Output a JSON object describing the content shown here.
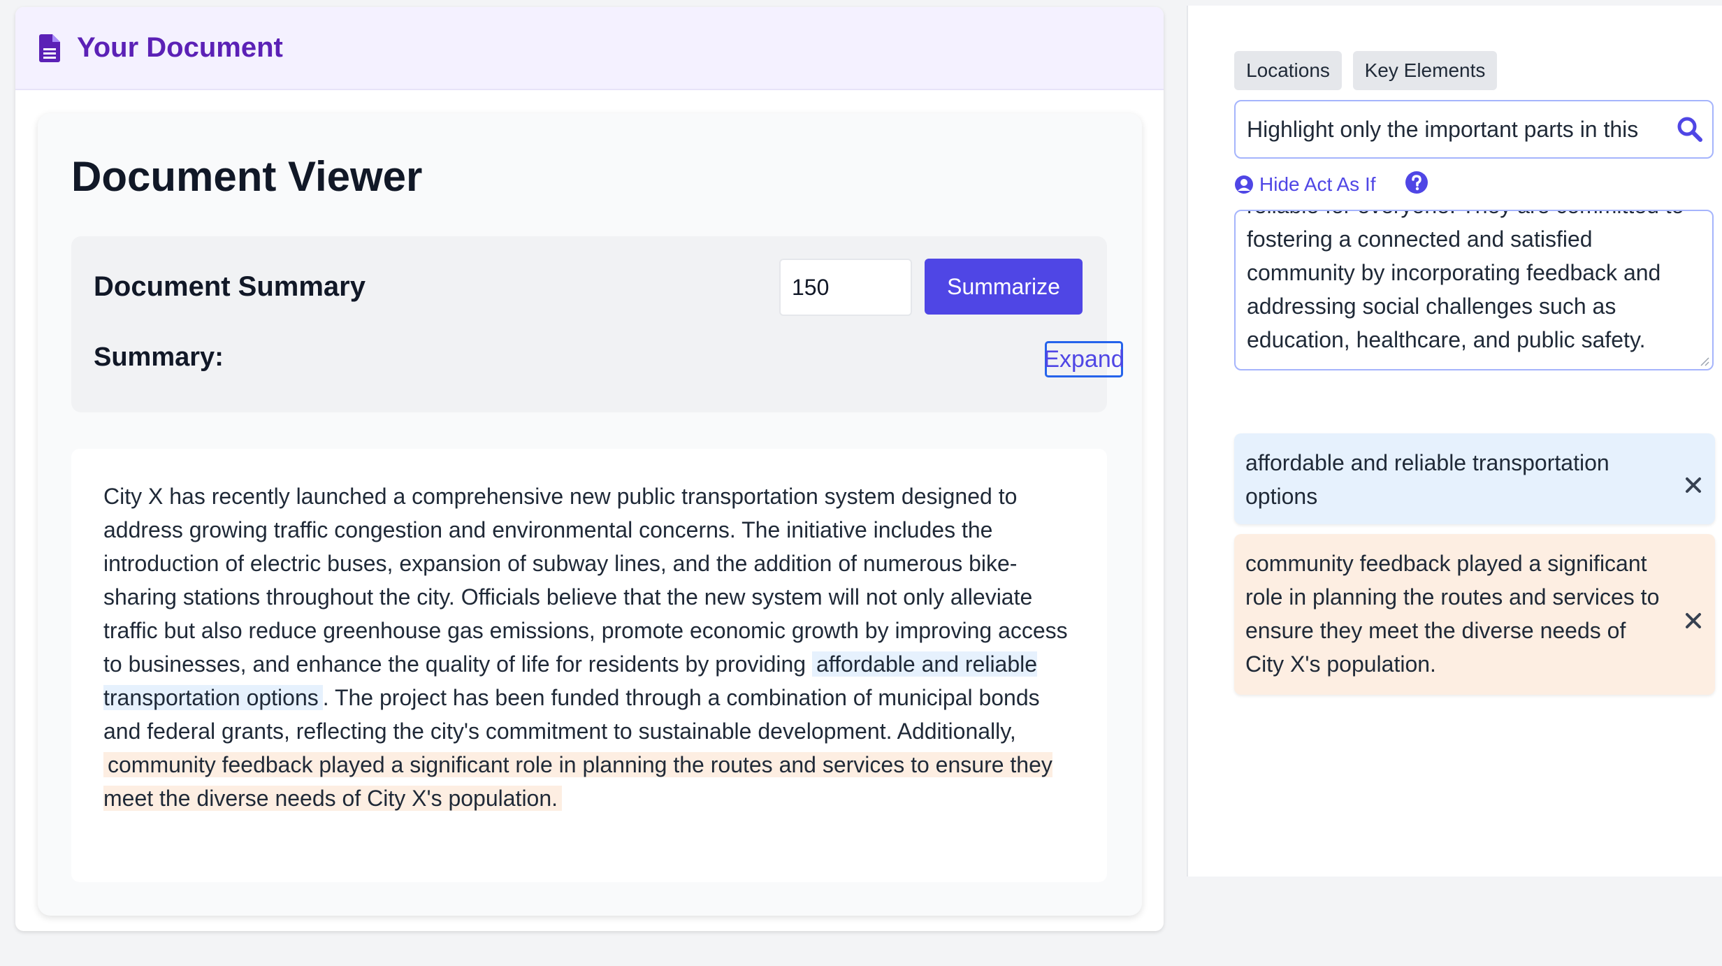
{
  "header": {
    "title": "Your Document",
    "icon": "document-icon"
  },
  "viewer": {
    "title": "Document Viewer",
    "summary": {
      "heading": "Document Summary",
      "length_value": "150",
      "summarize_label": "Summarize",
      "label": "Summary:",
      "expand_label": "Expand"
    },
    "body": {
      "p1": "City X has recently launched a comprehensive new public transportation system designed to address growing traffic congestion and environmental concerns. The initiative includes the introduction of electric buses, expansion of subway lines, and the addition of numerous bike-sharing stations throughout the city. Officials believe that the new system will not only alleviate traffic but also reduce greenhouse gas emissions, promote economic growth by improving access to businesses, and enhance the quality of life for residents by providing",
      "h1": "affordable and reliable transportation options",
      "p2": ". The project has been funded through a combination of municipal bonds and federal grants, reflecting the city's commitment to sustainable development. Additionally,",
      "h2": "community feedback played a significant role in planning the routes and services to ensure they meet the diverse needs of City X's population."
    }
  },
  "sidebar": {
    "tabs": [
      {
        "label": "Locations"
      },
      {
        "label": "Key Elements"
      }
    ],
    "search": {
      "value": "Highlight only the important parts in this",
      "icon": "search-icon"
    },
    "act_as_if": {
      "label": "Hide Act As If",
      "icon": "user-circle-icon",
      "help_icon": "question-circle-icon"
    },
    "act_text": "reliable for everyone. They are committed to fostering a connected and satisfied community by incorporating feedback and addressing social challenges such as education, healthcare, and public safety.",
    "highlights": [
      {
        "text": "affordable and reliable transportation options",
        "color": "#e6f1fd"
      },
      {
        "text": "community feedback played a significant role in planning the routes and services to ensure they meet the diverse needs of City X's population.",
        "color": "#fdeee2"
      }
    ]
  },
  "colors": {
    "accent": "#4f46e5",
    "header_title": "#5b21b6",
    "highlight_blue": "#e6f1fd",
    "highlight_orange": "#fdeee2"
  }
}
